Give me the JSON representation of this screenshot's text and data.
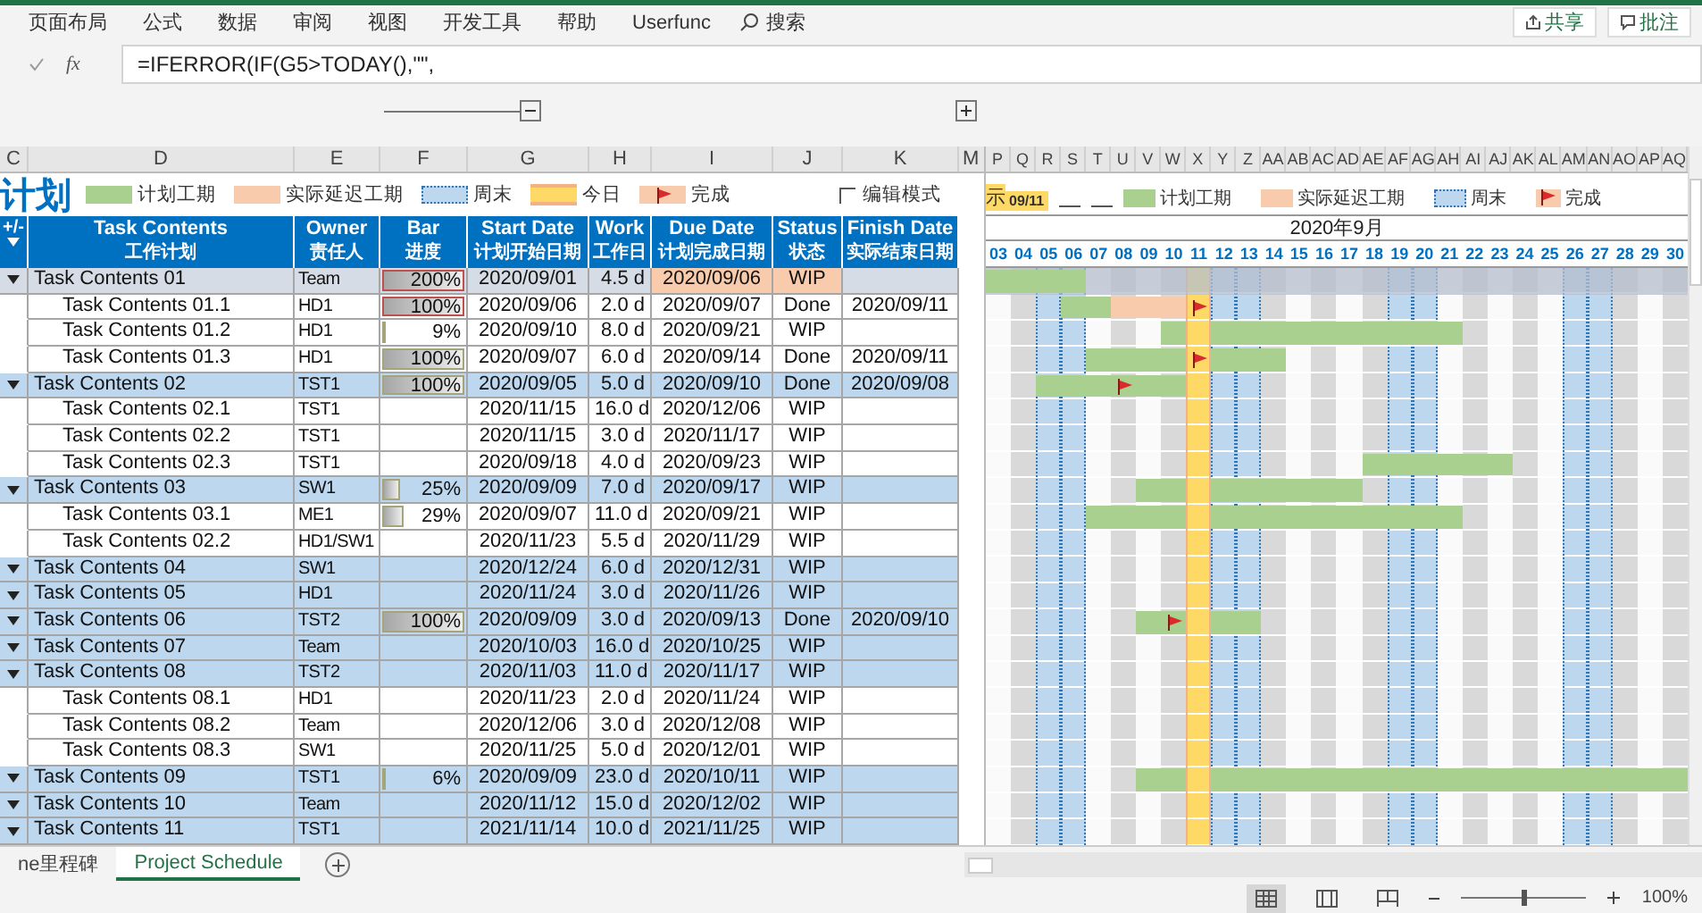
{
  "ribbon": {
    "tabs": [
      "页面布局",
      "公式",
      "数据",
      "审阅",
      "视图",
      "开发工具",
      "帮助",
      "Userfunc"
    ],
    "search": "搜索",
    "buttons": [
      "共享",
      "批注"
    ]
  },
  "formula_bar": {
    "fx": "fx",
    "formula": "=IFERROR(IF(G5>TODAY(),\"\","
  },
  "table_letters": [
    "C",
    "D",
    "E",
    "F",
    "G",
    "H",
    "I",
    "J",
    "K"
  ],
  "split_letter": "M",
  "gantt_letters": [
    "P",
    "Q",
    "R",
    "S",
    "T",
    "U",
    "V",
    "W",
    "X",
    "Y",
    "Z",
    "AA",
    "AB",
    "AC",
    "AD",
    "AE",
    "AF",
    "AG",
    "AH",
    "AI",
    "AJ",
    "AK",
    "AL",
    "AM",
    "AN",
    "AO",
    "AP",
    "AQ"
  ],
  "legend": {
    "title": "计划",
    "items": [
      {
        "kind": "plan",
        "label": "计划工期"
      },
      {
        "kind": "delay",
        "label": "实际延迟工期"
      },
      {
        "kind": "weekend",
        "label": "周末"
      },
      {
        "kind": "today",
        "label": "今日"
      },
      {
        "kind": "done",
        "label": "完成"
      }
    ],
    "edit_mode": {
      "label": "编辑模式",
      "checked": false
    }
  },
  "columns": [
    {
      "en": "+/-"
    },
    {
      "en": "Task Contents",
      "zh": "工作计划"
    },
    {
      "en": "Owner",
      "zh": "责任人"
    },
    {
      "en": "Bar",
      "zh": "进度"
    },
    {
      "en": "Start Date",
      "zh": "计划开始日期"
    },
    {
      "en": "Work",
      "zh": "工作日"
    },
    {
      "en": "Due Date",
      "zh": "计划完成日期"
    },
    {
      "en": "Status",
      "zh": "状态"
    },
    {
      "en": "Finish Date",
      "zh": "实际结束日期"
    }
  ],
  "tasks": [
    {
      "name": "Task Contents 01",
      "owner": "Team",
      "progress": {
        "text": "200%",
        "level": 1,
        "alert": true
      },
      "start": "2020/09/01",
      "work": "4.5 d",
      "due": "2020/09/06",
      "status": "WIP",
      "overdue": true,
      "selected": true,
      "expanded": true,
      "children": [
        {
          "name": "Task Contents 01.1",
          "owner": "HD1",
          "progress": {
            "text": "100%",
            "level": 1,
            "alert": true
          },
          "start": "2020/09/06",
          "work": "2.0 d",
          "due": "2020/09/07",
          "status": "Done",
          "finish": "2020/09/11",
          "overdue": false,
          "selected": false
        },
        {
          "name": "Task Contents 01.2",
          "owner": "HD1",
          "progress": {
            "text": "9%",
            "level": 0.09,
            "alert": false
          },
          "start": "2020/09/10",
          "work": "8.0 d",
          "due": "2020/09/21",
          "status": "WIP",
          "overdue": false,
          "selected": false
        },
        {
          "name": "Task Contents 01.3",
          "owner": "HD1",
          "progress": {
            "text": "100%",
            "level": 1,
            "alert": false
          },
          "start": "2020/09/07",
          "work": "6.0 d",
          "due": "2020/09/14",
          "status": "Done",
          "finish": "2020/09/11",
          "overdue": false,
          "selected": false
        }
      ]
    },
    {
      "name": "Task Contents 02",
      "owner": "TST1",
      "progress": {
        "text": "100%",
        "level": 1,
        "alert": false
      },
      "start": "2020/09/05",
      "work": "5.0 d",
      "due": "2020/09/10",
      "status": "Done",
      "finish": "2020/09/08",
      "overdue": false,
      "selected": false,
      "expanded": true,
      "children": [
        {
          "name": "Task Contents 02.1",
          "owner": "TST1",
          "start": "2020/11/15",
          "work": "16.0 d",
          "due": "2020/12/06",
          "status": "WIP",
          "overdue": false,
          "selected": false
        },
        {
          "name": "Task Contents 02.2",
          "owner": "TST1",
          "start": "2020/11/15",
          "work": "3.0 d",
          "due": "2020/11/17",
          "status": "WIP",
          "overdue": false,
          "selected": false
        },
        {
          "name": "Task Contents 02.3",
          "owner": "TST1",
          "start": "2020/09/18",
          "work": "4.0 d",
          "due": "2020/09/23",
          "status": "WIP",
          "overdue": false,
          "selected": false
        }
      ]
    },
    {
      "name": "Task Contents 03",
      "owner": "SW1",
      "progress": {
        "text": "25%",
        "level": 0.25,
        "alert": false
      },
      "start": "2020/09/09",
      "work": "7.0 d",
      "due": "2020/09/17",
      "status": "WIP",
      "overdue": false,
      "selected": false,
      "expanded": true,
      "children": [
        {
          "name": "Task Contents 03.1",
          "owner": "ME1",
          "progress": {
            "text": "29%",
            "level": 0.29,
            "alert": false
          },
          "start": "2020/09/07",
          "work": "11.0 d",
          "due": "2020/09/21",
          "status": "WIP",
          "overdue": false,
          "selected": false
        },
        {
          "name": "Task Contents 02.2",
          "owner": "HD1/SW1",
          "start": "2020/11/23",
          "work": "5.5 d",
          "due": "2020/11/29",
          "status": "WIP",
          "overdue": false,
          "selected": false
        }
      ]
    },
    {
      "name": "Task Contents 04",
      "owner": "SW1",
      "start": "2020/12/24",
      "work": "6.0 d",
      "due": "2020/12/31",
      "status": "WIP",
      "overdue": false,
      "selected": false,
      "expanded": true
    },
    {
      "name": "Task Contents 05",
      "owner": "HD1",
      "start": "2020/11/24",
      "work": "3.0 d",
      "due": "2020/11/26",
      "status": "WIP",
      "overdue": false,
      "selected": false,
      "expanded": true
    },
    {
      "name": "Task Contents 06",
      "owner": "TST2",
      "progress": {
        "text": "100%",
        "level": 1,
        "alert": false
      },
      "start": "2020/09/09",
      "work": "3.0 d",
      "due": "2020/09/13",
      "status": "Done",
      "finish": "2020/09/10",
      "overdue": false,
      "selected": false,
      "expanded": true
    },
    {
      "name": "Task Contents 07",
      "owner": "Team",
      "start": "2020/10/03",
      "work": "16.0 d",
      "due": "2020/10/25",
      "status": "WIP",
      "overdue": false,
      "selected": false,
      "expanded": true
    },
    {
      "name": "Task Contents 08",
      "owner": "TST2",
      "start": "2020/11/03",
      "work": "11.0 d",
      "due": "2020/11/17",
      "status": "WIP",
      "overdue": false,
      "selected": false,
      "expanded": true,
      "children": [
        {
          "name": "Task Contents 08.1",
          "owner": "HD1",
          "start": "2020/11/23",
          "work": "2.0 d",
          "due": "2020/11/24",
          "status": "WIP",
          "overdue": false,
          "selected": false
        },
        {
          "name": "Task Contents 08.2",
          "owner": "Team",
          "start": "2020/12/06",
          "work": "3.0 d",
          "due": "2020/12/08",
          "status": "WIP",
          "overdue": false,
          "selected": false
        },
        {
          "name": "Task Contents 08.3",
          "owner": "SW1",
          "start": "2020/11/25",
          "work": "5.0 d",
          "due": "2020/12/01",
          "status": "WIP",
          "overdue": false,
          "selected": false
        }
      ]
    },
    {
      "name": "Task Contents 09",
      "owner": "TST1",
      "progress": {
        "text": "6%",
        "level": 0.06,
        "alert": false
      },
      "start": "2020/09/09",
      "work": "23.0 d",
      "due": "2020/10/11",
      "status": "WIP",
      "overdue": false,
      "selected": false,
      "expanded": true
    },
    {
      "name": "Task Contents 10",
      "owner": "Team",
      "start": "2020/11/12",
      "work": "15.0 d",
      "due": "2020/12/02",
      "status": "WIP",
      "overdue": false,
      "selected": false,
      "expanded": true
    },
    {
      "name": "Task Contents 11",
      "owner": "TST1",
      "start": "2021/11/14",
      "work": "10.0 d",
      "due": "2021/11/25",
      "status": "WIP",
      "overdue": false,
      "selected": false,
      "expanded": true
    }
  ],
  "gantt": {
    "today_label": "示",
    "today": "09/11",
    "items": [
      {
        "kind": "plan",
        "label": "计划工期"
      },
      {
        "kind": "delay",
        "label": "实际延迟工期"
      },
      {
        "kind": "weekend",
        "label": "周末"
      },
      {
        "kind": "done",
        "label": "完成"
      }
    ],
    "month": "2020年9月",
    "days": [
      {
        "label": "03",
        "weekend": false
      },
      {
        "label": "04",
        "weekend": false
      },
      {
        "label": "05",
        "weekend": true
      },
      {
        "label": "06",
        "weekend": true
      },
      {
        "label": "07",
        "weekend": false
      },
      {
        "label": "08",
        "weekend": false
      },
      {
        "label": "09",
        "weekend": false
      },
      {
        "label": "10",
        "weekend": false
      },
      {
        "label": "11",
        "weekend": false
      },
      {
        "label": "12",
        "weekend": true
      },
      {
        "label": "13",
        "weekend": true
      },
      {
        "label": "14",
        "weekend": false
      },
      {
        "label": "15",
        "weekend": false
      },
      {
        "label": "16",
        "weekend": false
      },
      {
        "label": "17",
        "weekend": false
      },
      {
        "label": "18",
        "weekend": false
      },
      {
        "label": "19",
        "weekend": true
      },
      {
        "label": "20",
        "weekend": true
      },
      {
        "label": "21",
        "weekend": false
      },
      {
        "label": "22",
        "weekend": false
      },
      {
        "label": "23",
        "weekend": false
      },
      {
        "label": "24",
        "weekend": false
      },
      {
        "label": "25",
        "weekend": false
      },
      {
        "label": "26",
        "weekend": true
      },
      {
        "label": "27",
        "weekend": true
      },
      {
        "label": "28",
        "weekend": false
      },
      {
        "label": "29",
        "weekend": false
      },
      {
        "label": "30",
        "weekend": false
      }
    ]
  },
  "sheets": [
    {
      "label": "ne里程碑",
      "selected": false
    },
    {
      "label": "Project Schedule",
      "selected": true
    }
  ],
  "status_bar": {
    "zoom": "100%",
    "zoom_slider": {
      "level": 0.5
    }
  }
}
